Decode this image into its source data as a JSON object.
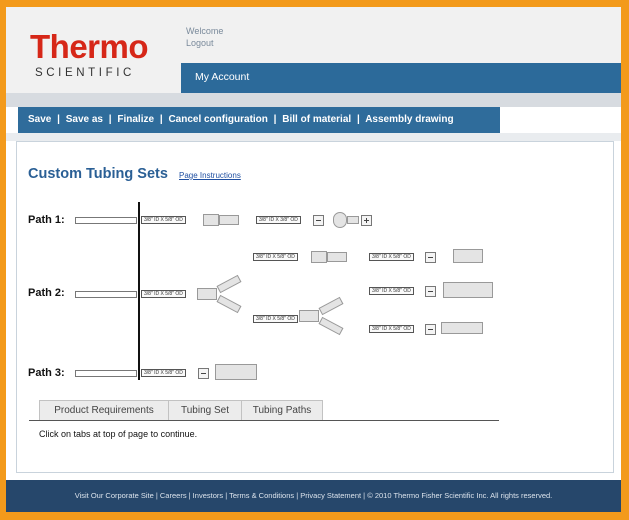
{
  "brand": {
    "logo_word": "Thermo",
    "logo_sub": "SCIENTIFIC"
  },
  "header": {
    "welcome": "Welcome",
    "logout": "Logout",
    "my_account": "My Account"
  },
  "toolbar": {
    "items": [
      "Save",
      "Save as",
      "Finalize",
      "Cancel configuration",
      "Bill of material",
      "Assembly drawing"
    ],
    "separator": "|"
  },
  "page": {
    "title": "Custom Tubing Sets",
    "instructions_link": "Page Instructions"
  },
  "paths": {
    "path1": "Path 1:",
    "path2": "Path 2:",
    "path3": "Path 3:"
  },
  "tags": {
    "t1": "3/8\" ID X 5/8\" OD",
    "t2": "3/8\" ID X 3/8\" OD",
    "t3": "3/8\" ID X 5/8\" OD",
    "t4": "3/8\" ID X 5/8\" OD"
  },
  "tabs": [
    "Product Requirements",
    "Tubing Set",
    "Tubing Paths"
  ],
  "tab_message": "Click on tabs at top of page to continue.",
  "footer": {
    "text": "Visit Our Corporate Site | Careers | Investors | Terms & Conditions | Privacy Statement | © 2010 Thermo Fisher Scientific Inc. All rights reserved."
  },
  "colors": {
    "accent_orange": "#f39a1b",
    "brand_red": "#d62718",
    "nav_blue": "#2f6c9b",
    "footer_navy": "#26476b"
  }
}
